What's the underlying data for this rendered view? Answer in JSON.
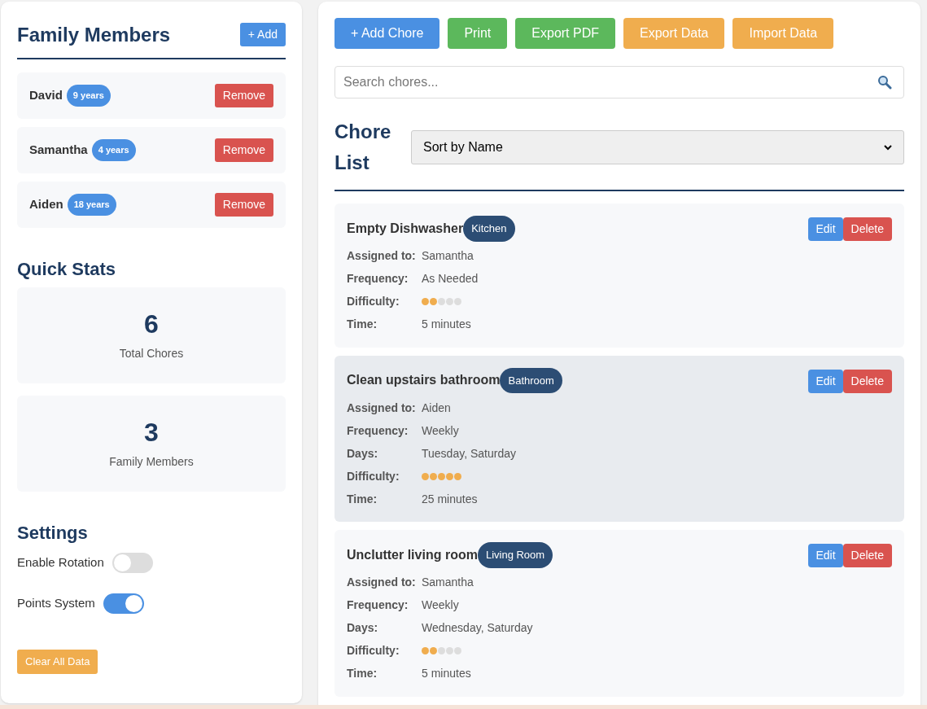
{
  "family": {
    "title": "Family Members",
    "add_button": "+ Add",
    "members": [
      {
        "name": "David",
        "age": "9 years",
        "remove_label": "Remove"
      },
      {
        "name": "Samantha",
        "age": "4 years",
        "remove_label": "Remove"
      },
      {
        "name": "Aiden",
        "age": "18 years",
        "remove_label": "Remove"
      }
    ]
  },
  "quick_stats": {
    "title": "Quick Stats",
    "stats": [
      {
        "value": "6",
        "label": "Total Chores"
      },
      {
        "value": "3",
        "label": "Family Members"
      }
    ]
  },
  "settings": {
    "title": "Settings",
    "toggles": [
      {
        "label": "Enable Rotation",
        "on": false
      },
      {
        "label": "Points System",
        "on": true
      }
    ],
    "clear_button": "Clear All Data"
  },
  "toolbar": [
    {
      "label": "+ Add Chore",
      "kind": "primary"
    },
    {
      "label": "Print",
      "kind": "success"
    },
    {
      "label": "Export PDF",
      "kind": "success"
    },
    {
      "label": "Export Data",
      "kind": "warning"
    },
    {
      "label": "Import Data",
      "kind": "warning"
    }
  ],
  "search": {
    "placeholder": "Search chores..."
  },
  "chore_list": {
    "title": "Chore List",
    "sort": "Sort by Name",
    "chores": [
      {
        "name": "Empty Dishwasher",
        "room": "Kitchen",
        "edit_label": "Edit",
        "delete_label": "Delete",
        "highlighted": false,
        "fields": [
          {
            "kind": "text",
            "label": "Assigned to:",
            "value": "Samantha"
          },
          {
            "kind": "text",
            "label": "Frequency:",
            "value": "As Needed"
          },
          {
            "kind": "dots",
            "label": "Difficulty:",
            "stars": 2
          },
          {
            "kind": "text",
            "label": "Time:",
            "value": "5 minutes"
          }
        ]
      },
      {
        "name": "Clean upstairs bathroom",
        "room": "Bathroom",
        "edit_label": "Edit",
        "delete_label": "Delete",
        "highlighted": true,
        "fields": [
          {
            "kind": "text",
            "label": "Assigned to:",
            "value": "Aiden"
          },
          {
            "kind": "text",
            "label": "Frequency:",
            "value": "Weekly"
          },
          {
            "kind": "text",
            "label": "Days:",
            "value": "Tuesday, Saturday"
          },
          {
            "kind": "dots",
            "label": "Difficulty:",
            "stars": 5
          },
          {
            "kind": "text",
            "label": "Time:",
            "value": "25 minutes"
          }
        ]
      },
      {
        "name": "Unclutter living room",
        "room": "Living Room",
        "edit_label": "Edit",
        "delete_label": "Delete",
        "highlighted": false,
        "fields": [
          {
            "kind": "text",
            "label": "Assigned to:",
            "value": "Samantha"
          },
          {
            "kind": "text",
            "label": "Frequency:",
            "value": "Weekly"
          },
          {
            "kind": "text",
            "label": "Days:",
            "value": "Wednesday, Saturday"
          },
          {
            "kind": "dots",
            "label": "Difficulty:",
            "stars": 2
          },
          {
            "kind": "text",
            "label": "Time:",
            "value": "5 minutes"
          }
        ]
      }
    ]
  }
}
